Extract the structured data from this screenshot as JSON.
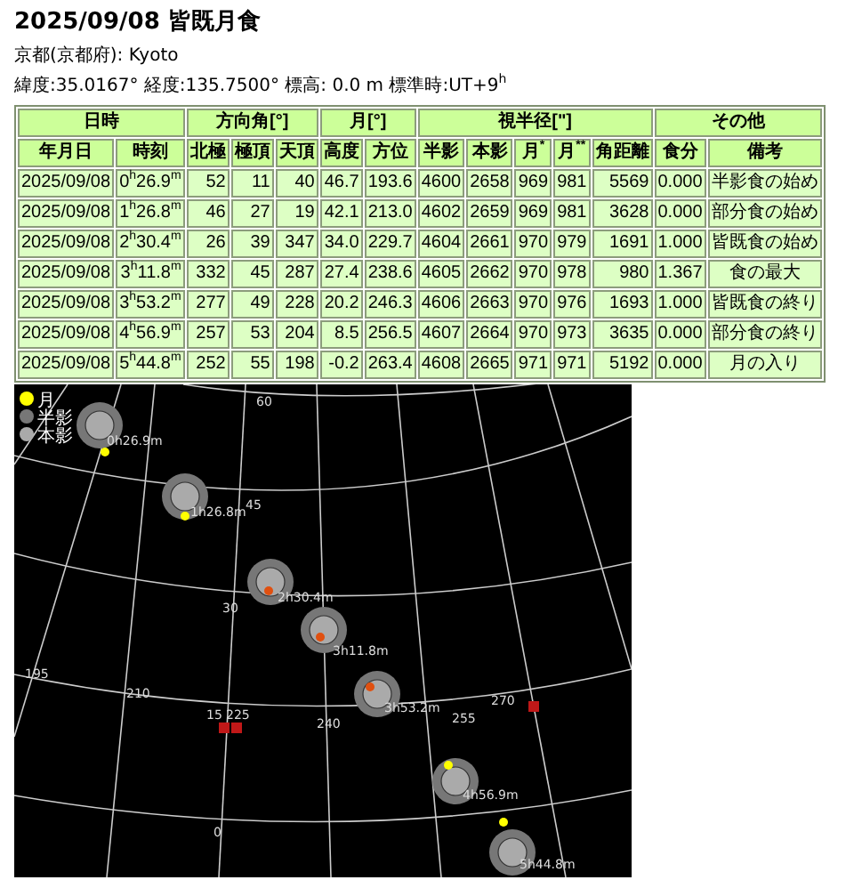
{
  "title": "2025/09/08 皆既月食",
  "location": "京都(京都府): Kyoto",
  "coordinates": "緯度:35.0167° 経度:135.7500° 標高: 0.0 m 標準時:UT+9$^{h}$",
  "table": {
    "group_headers": [
      {
        "label": "日時"
      },
      {
        "label": "方向角[°]"
      },
      {
        "label": "月[°]"
      },
      {
        "label": "視半径[\"]"
      },
      {
        "label": "その他"
      }
    ],
    "columns": [
      "年月日",
      "時刻",
      "北極",
      "極頂",
      "天頂",
      "高度",
      "方位",
      "半影",
      "本影",
      "月$^{*}$",
      "月$^{**}$",
      "角距離",
      "食分",
      "備考"
    ],
    "rows": [
      [
        "2025/09/08",
        "0$^{h}$26.9$^{m}$",
        "52",
        "11",
        "40",
        "46.7",
        "193.6",
        "4600",
        "2658",
        "969",
        "981",
        "5569",
        "0.000",
        "半影食の始め"
      ],
      [
        "2025/09/08",
        "1$^{h}$26.8$^{m}$",
        "46",
        "27",
        "19",
        "42.1",
        "213.0",
        "4602",
        "2659",
        "969",
        "981",
        "3628",
        "0.000",
        "部分食の始め"
      ],
      [
        "2025/09/08",
        "2$^{h}$30.4$^{m}$",
        "26",
        "39",
        "347",
        "34.0",
        "229.7",
        "4604",
        "2661",
        "970",
        "979",
        "1691",
        "1.000",
        "皆既食の始め"
      ],
      [
        "2025/09/08",
        "3$^{h}$11.8$^{m}$",
        "332",
        "45",
        "287",
        "27.4",
        "238.6",
        "4605",
        "2662",
        "970",
        "978",
        "980",
        "1.367",
        "食の最大"
      ],
      [
        "2025/09/08",
        "3$^{h}$53.2$^{m}$",
        "277",
        "49",
        "228",
        "20.2",
        "246.3",
        "4606",
        "2663",
        "970",
        "976",
        "1693",
        "1.000",
        "皆既食の終り"
      ],
      [
        "2025/09/08",
        "4$^{h}$56.9$^{m}$",
        "257",
        "53",
        "204",
        "8.5",
        "256.5",
        "4607",
        "2664",
        "970",
        "973",
        "3635",
        "0.000",
        "部分食の終り"
      ],
      [
        "2025/09/08",
        "5$^{h}$44.8$^{m}$",
        "252",
        "55",
        "198",
        "-0.2",
        "263.4",
        "4608",
        "2665",
        "971",
        "971",
        "5192",
        "0.000",
        "月の入り"
      ]
    ]
  },
  "sky_map": {
    "legend": [
      {
        "label": "月",
        "kind": "moon"
      },
      {
        "label": "半影",
        "kind": "penumbra"
      },
      {
        "label": "本影",
        "kind": "umbra"
      }
    ],
    "altitude_labels": [
      "60",
      "45",
      "30",
      "15",
      "0"
    ],
    "azimuth_labels": [
      "195",
      "210",
      "225",
      "240",
      "255",
      "270"
    ],
    "moons": [
      {
        "label": "0h26.9m",
        "color": "#ffff00"
      },
      {
        "label": "1h26.8m",
        "color": "#ffff00"
      },
      {
        "label": "2h30.4m",
        "color": "#e05010"
      },
      {
        "label": "3h11.8m",
        "color": "#e05010"
      },
      {
        "label": "3h53.2m",
        "color": "#e05010"
      },
      {
        "label": "4h56.9m",
        "color": "#ffff00"
      },
      {
        "label": "5h44.8m",
        "color": "#ffff00"
      }
    ]
  }
}
